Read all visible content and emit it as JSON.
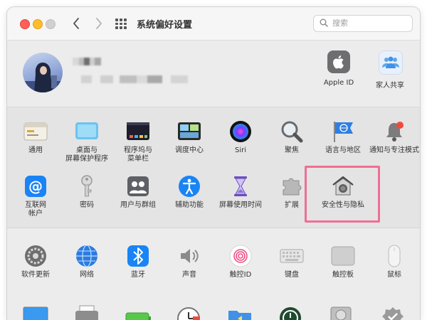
{
  "window": {
    "title": "系统偏好设置",
    "search_placeholder": "搜索"
  },
  "account": {
    "apple_id_label": "Apple ID",
    "family_label": "家人共享"
  },
  "section1": [
    {
      "label": "通用",
      "icon": "general-icon"
    },
    {
      "label": "桌面与\n屏幕保护程序",
      "icon": "desktop-screensaver-icon"
    },
    {
      "label": "程序坞与\n菜单栏",
      "icon": "dock-menubar-icon"
    },
    {
      "label": "调度中心",
      "icon": "mission-control-icon"
    },
    {
      "label": "Siri",
      "icon": "siri-icon"
    },
    {
      "label": "聚焦",
      "icon": "spotlight-icon"
    },
    {
      "label": "语言与地区",
      "icon": "language-region-icon"
    },
    {
      "label": "通知与专注模式",
      "icon": "notifications-icon"
    },
    {
      "label": "互联网\n帐户",
      "icon": "internet-accounts-icon"
    },
    {
      "label": "密码",
      "icon": "passwords-icon"
    },
    {
      "label": "用户与群组",
      "icon": "users-groups-icon"
    },
    {
      "label": "辅助功能",
      "icon": "accessibility-icon"
    },
    {
      "label": "屏幕使用时间",
      "icon": "screen-time-icon"
    },
    {
      "label": "扩展",
      "icon": "extensions-icon"
    },
    {
      "label": "安全性与隐私",
      "icon": "security-privacy-icon"
    }
  ],
  "section2": [
    {
      "label": "软件更新",
      "icon": "software-update-icon"
    },
    {
      "label": "网络",
      "icon": "network-icon"
    },
    {
      "label": "蓝牙",
      "icon": "bluetooth-icon"
    },
    {
      "label": "声音",
      "icon": "sound-icon"
    },
    {
      "label": "触控ID",
      "icon": "touch-id-icon"
    },
    {
      "label": "键盘",
      "icon": "keyboard-icon"
    },
    {
      "label": "触控板",
      "icon": "trackpad-icon"
    },
    {
      "label": "鼠标",
      "icon": "mouse-icon"
    }
  ],
  "section3_icons": [
    "displays-icon",
    "printers-icon",
    "battery-icon",
    "date-time-icon",
    "sharing-icon",
    "time-machine-icon",
    "startup-disk-icon",
    "profiles-icon"
  ],
  "colors": {
    "highlight": "#ee6f95",
    "accent": "#1a84f5"
  }
}
